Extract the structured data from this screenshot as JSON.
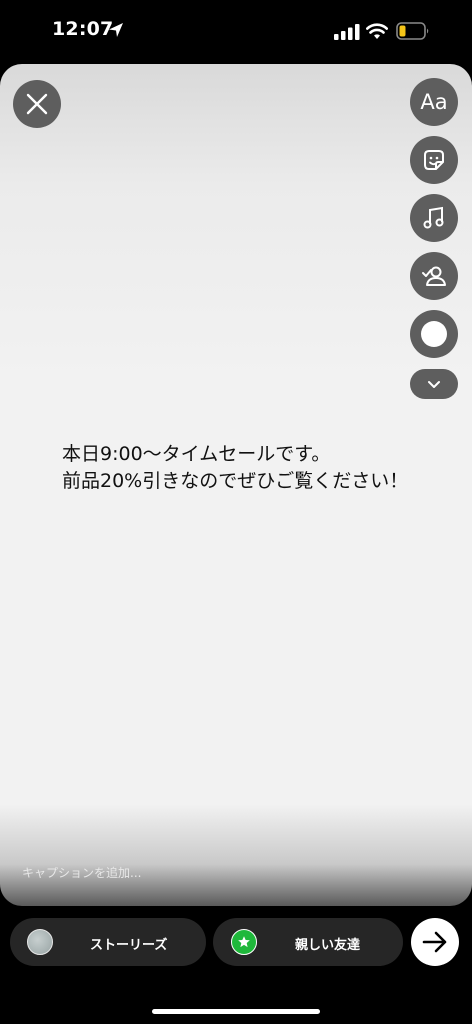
{
  "status_bar": {
    "time": "12:07",
    "icons": [
      "location-arrow-icon",
      "signal-icon",
      "wifi-icon",
      "battery-icon"
    ]
  },
  "toolbar": {
    "close_icon": "close-icon",
    "text_tool_label": "Aa",
    "tools": [
      "text-tool",
      "sticker-icon",
      "music-icon",
      "mention-icon",
      "draw-circle-icon"
    ],
    "more_icon": "chevron-down-icon"
  },
  "story": {
    "text": "本日9:00〜タイムセールです。\n前品20%引きなのでぜひご覧ください！"
  },
  "caption": {
    "placeholder": "キャプションを追加..."
  },
  "share": {
    "stories_label": "ストーリーズ",
    "close_friends_label": "親しい友達",
    "close_friends_color": "#1fb83b",
    "next_icon": "arrow-right-icon"
  }
}
